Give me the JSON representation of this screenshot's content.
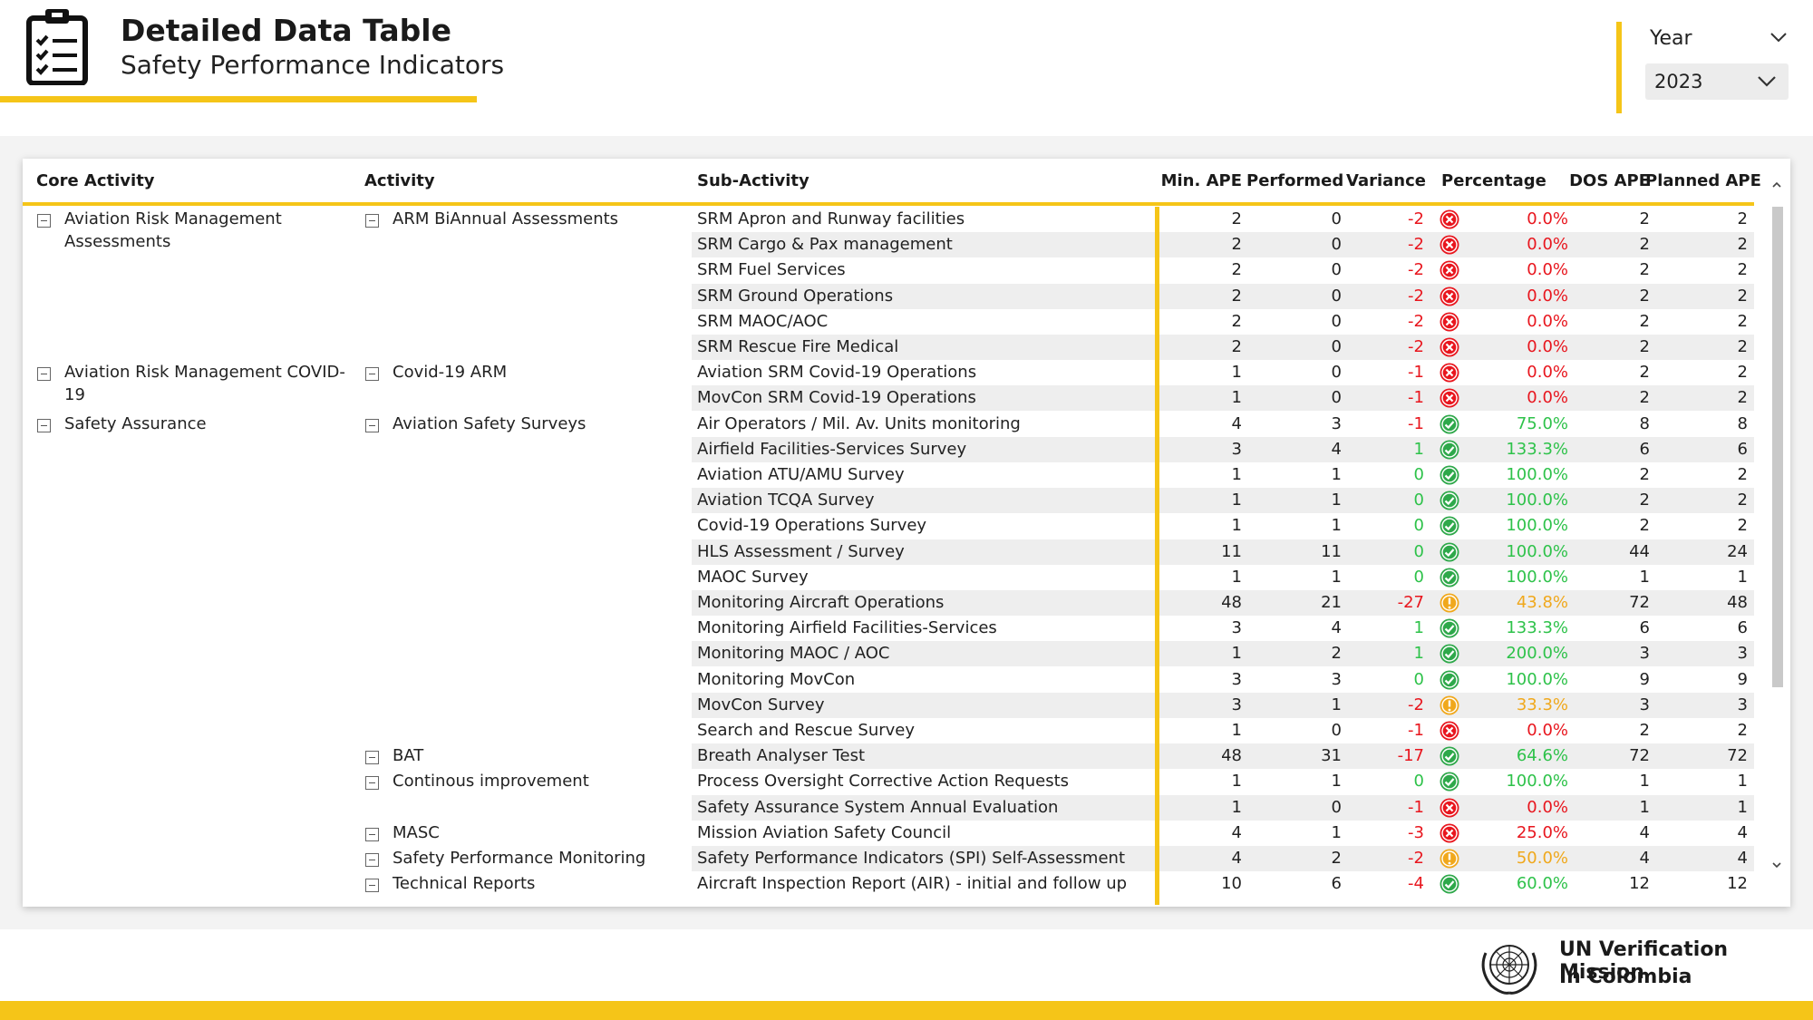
{
  "header": {
    "title": "Detailed Data Table",
    "subtitle": "Safety Performance Indicators",
    "icon": "clipboard-checklist-icon"
  },
  "filter": {
    "year_label": "Year",
    "year_value": "2023"
  },
  "columns": {
    "core_activity": "Core Activity",
    "activity": "Activity",
    "sub_activity": "Sub-Activity",
    "min_ape": "Min. APE",
    "performed": "Performed",
    "variance": "Variance",
    "percentage": "Percentage",
    "dos_ape": "DOS APE",
    "planned_ape": "Planned APE"
  },
  "core_groups": [
    {
      "label": "Aviation Risk Management Assessments",
      "row": 0
    },
    {
      "label": "Aviation Risk Management COVID-19",
      "row": 6
    },
    {
      "label": "Safety Assurance",
      "row": 8
    }
  ],
  "activity_groups": [
    {
      "label": "ARM BiAnnual Assessments",
      "row": 0
    },
    {
      "label": "Covid-19 ARM",
      "row": 6
    },
    {
      "label": "Aviation Safety Surveys",
      "row": 8
    },
    {
      "label": "BAT",
      "row": 21
    },
    {
      "label": "Continous improvement",
      "row": 22
    },
    {
      "label": "MASC",
      "row": 24
    },
    {
      "label": "Safety Performance Monitoring",
      "row": 25
    },
    {
      "label": "Technical Reports",
      "row": 26
    }
  ],
  "rows": [
    {
      "sub": "SRM Apron and Runway facilities",
      "min": "2",
      "perf": "0",
      "var": "-2",
      "status": "fail",
      "pct": "0.0%",
      "dos": "2",
      "planned": "2"
    },
    {
      "sub": "SRM Cargo & Pax management",
      "min": "2",
      "perf": "0",
      "var": "-2",
      "status": "fail",
      "pct": "0.0%",
      "dos": "2",
      "planned": "2"
    },
    {
      "sub": "SRM Fuel Services",
      "min": "2",
      "perf": "0",
      "var": "-2",
      "status": "fail",
      "pct": "0.0%",
      "dos": "2",
      "planned": "2"
    },
    {
      "sub": "SRM Ground Operations",
      "min": "2",
      "perf": "0",
      "var": "-2",
      "status": "fail",
      "pct": "0.0%",
      "dos": "2",
      "planned": "2"
    },
    {
      "sub": "SRM MAOC/AOC",
      "min": "2",
      "perf": "0",
      "var": "-2",
      "status": "fail",
      "pct": "0.0%",
      "dos": "2",
      "planned": "2"
    },
    {
      "sub": "SRM Rescue Fire Medical",
      "min": "2",
      "perf": "0",
      "var": "-2",
      "status": "fail",
      "pct": "0.0%",
      "dos": "2",
      "planned": "2"
    },
    {
      "sub": "Aviation SRM Covid-19 Operations",
      "min": "1",
      "perf": "0",
      "var": "-1",
      "status": "fail",
      "pct": "0.0%",
      "dos": "2",
      "planned": "2"
    },
    {
      "sub": "MovCon SRM Covid-19 Operations",
      "min": "1",
      "perf": "0",
      "var": "-1",
      "status": "fail",
      "pct": "0.0%",
      "dos": "2",
      "planned": "2"
    },
    {
      "sub": "Air Operators / Mil. Av. Units monitoring",
      "min": "4",
      "perf": "3",
      "var": "-1",
      "status": "ok",
      "pct": "75.0%",
      "dos": "8",
      "planned": "8"
    },
    {
      "sub": "Airfield Facilities-Services Survey",
      "min": "3",
      "perf": "4",
      "var": "1",
      "status": "ok",
      "pct": "133.3%",
      "dos": "6",
      "planned": "6"
    },
    {
      "sub": "Aviation ATU/AMU Survey",
      "min": "1",
      "perf": "1",
      "var": "0",
      "status": "ok",
      "pct": "100.0%",
      "dos": "2",
      "planned": "2"
    },
    {
      "sub": "Aviation TCQA Survey",
      "min": "1",
      "perf": "1",
      "var": "0",
      "status": "ok",
      "pct": "100.0%",
      "dos": "2",
      "planned": "2"
    },
    {
      "sub": "Covid-19 Operations Survey",
      "min": "1",
      "perf": "1",
      "var": "0",
      "status": "ok",
      "pct": "100.0%",
      "dos": "2",
      "planned": "2"
    },
    {
      "sub": "HLS Assessment / Survey",
      "min": "11",
      "perf": "11",
      "var": "0",
      "status": "ok",
      "pct": "100.0%",
      "dos": "44",
      "planned": "24"
    },
    {
      "sub": "MAOC Survey",
      "min": "1",
      "perf": "1",
      "var": "0",
      "status": "ok",
      "pct": "100.0%",
      "dos": "1",
      "planned": "1"
    },
    {
      "sub": "Monitoring Aircraft Operations",
      "min": "48",
      "perf": "21",
      "var": "-27",
      "status": "warn",
      "pct": "43.8%",
      "dos": "72",
      "planned": "48"
    },
    {
      "sub": "Monitoring Airfield Facilities-Services",
      "min": "3",
      "perf": "4",
      "var": "1",
      "status": "ok",
      "pct": "133.3%",
      "dos": "6",
      "planned": "6"
    },
    {
      "sub": "Monitoring MAOC / AOC",
      "min": "1",
      "perf": "2",
      "var": "1",
      "status": "ok",
      "pct": "200.0%",
      "dos": "3",
      "planned": "3"
    },
    {
      "sub": "Monitoring MovCon",
      "min": "3",
      "perf": "3",
      "var": "0",
      "status": "ok",
      "pct": "100.0%",
      "dos": "9",
      "planned": "9"
    },
    {
      "sub": "MovCon Survey",
      "min": "3",
      "perf": "1",
      "var": "-2",
      "status": "warn",
      "pct": "33.3%",
      "dos": "3",
      "planned": "3"
    },
    {
      "sub": "Search and Rescue Survey",
      "min": "1",
      "perf": "0",
      "var": "-1",
      "status": "fail",
      "pct": "0.0%",
      "dos": "2",
      "planned": "2"
    },
    {
      "sub": "Breath Analyser Test",
      "min": "48",
      "perf": "31",
      "var": "-17",
      "status": "ok",
      "pct": "64.6%",
      "dos": "72",
      "planned": "72"
    },
    {
      "sub": "Process Oversight Corrective Action Requests",
      "min": "1",
      "perf": "1",
      "var": "0",
      "status": "ok",
      "pct": "100.0%",
      "dos": "1",
      "planned": "1"
    },
    {
      "sub": "Safety Assurance System Annual Evaluation",
      "min": "1",
      "perf": "0",
      "var": "-1",
      "status": "fail",
      "pct": "0.0%",
      "dos": "1",
      "planned": "1"
    },
    {
      "sub": "Mission Aviation Safety Council",
      "min": "4",
      "perf": "1",
      "var": "-3",
      "status": "fail",
      "pct": "25.0%",
      "dos": "4",
      "planned": "4"
    },
    {
      "sub": "Safety Performance Indicators (SPI) Self-Assessment",
      "min": "4",
      "perf": "2",
      "var": "-2",
      "status": "warn",
      "pct": "50.0%",
      "dos": "4",
      "planned": "4"
    },
    {
      "sub": "Aircraft Inspection Report (AIR) - initial and follow up",
      "min": "10",
      "perf": "6",
      "var": "-4",
      "status": "ok",
      "pct": "60.0%",
      "dos": "12",
      "planned": "12"
    }
  ],
  "status_colors": {
    "fail": "#e8161e",
    "ok": "#2ea84a",
    "warn": "#f0a81c"
  },
  "pct_colors": {
    "fail": "#e8161e",
    "ok": "#2ec24a",
    "warn": "#f0a81c"
  },
  "footer": {
    "org_line1": "UN Verification Mission",
    "org_line2": "In Colombia",
    "logo": "un-emblem-icon"
  },
  "accent_color": "#f5c518"
}
